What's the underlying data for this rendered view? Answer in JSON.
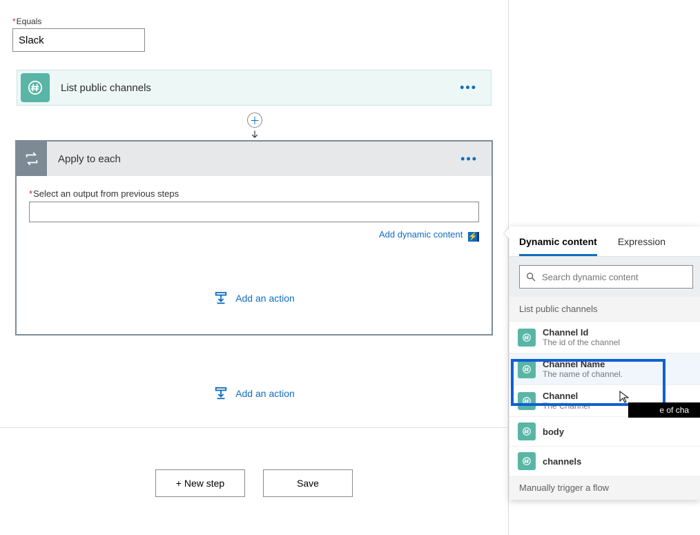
{
  "equals": {
    "label": "Equals",
    "value": "Slack"
  },
  "slack_card": {
    "title": "List public channels"
  },
  "apply_each": {
    "title": "Apply to each",
    "select_label": "Select an output from previous steps",
    "add_dynamic": "Add dynamic content",
    "add_action": "Add an action"
  },
  "outer": {
    "add_action": "Add an action"
  },
  "buttons": {
    "new_step": "+ New step",
    "save": "Save"
  },
  "popout": {
    "tab_dynamic": "Dynamic content",
    "tab_expression": "Expression",
    "search_placeholder": "Search dynamic content",
    "section1": "List public channels",
    "section2": "Manually trigger a flow",
    "items": [
      {
        "title": "Channel Id",
        "desc": "The id of the channel"
      },
      {
        "title": "Channel Name",
        "desc": "The name of channel."
      },
      {
        "title": "Channel",
        "desc": "The Channel"
      },
      {
        "title": "body",
        "desc": ""
      },
      {
        "title": "channels",
        "desc": ""
      }
    ],
    "tooltip": "The name of channel."
  }
}
